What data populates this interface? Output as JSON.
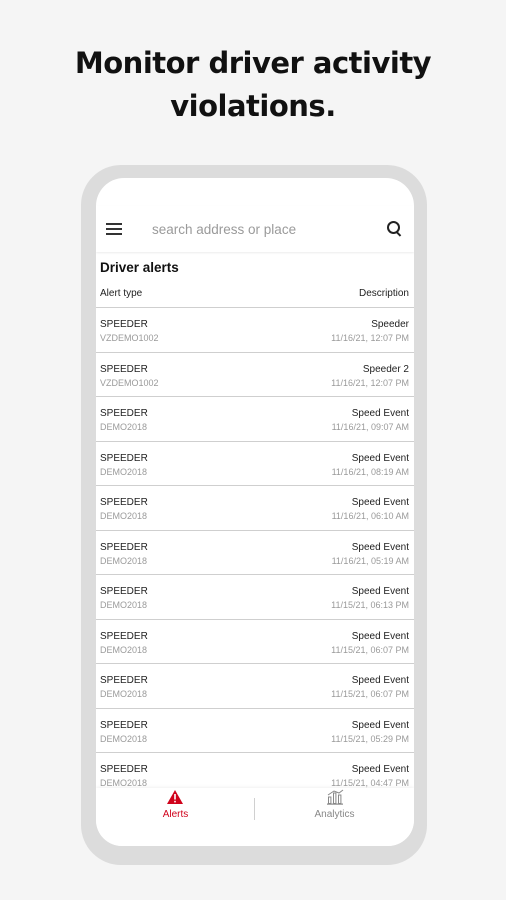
{
  "headline": {
    "line1": "Monitor driver activity",
    "line2": "violations."
  },
  "search": {
    "placeholder": "search address or place"
  },
  "section_title": "Driver alerts",
  "columns": {
    "left": "Alert type",
    "right": "Description"
  },
  "alerts": [
    {
      "type": "SPEEDER",
      "driver": "VZDEMO1002",
      "description": "Speeder",
      "time": "11/16/21, 12:07 PM"
    },
    {
      "type": "SPEEDER",
      "driver": "VZDEMO1002",
      "description": "Speeder 2",
      "time": "11/16/21, 12:07 PM"
    },
    {
      "type": "SPEEDER",
      "driver": "DEMO2018",
      "description": "Speed Event",
      "time": "11/16/21, 09:07 AM"
    },
    {
      "type": "SPEEDER",
      "driver": "DEMO2018",
      "description": "Speed Event",
      "time": "11/16/21, 08:19 AM"
    },
    {
      "type": "SPEEDER",
      "driver": "DEMO2018",
      "description": "Speed Event",
      "time": "11/16/21, 06:10 AM"
    },
    {
      "type": "SPEEDER",
      "driver": "DEMO2018",
      "description": "Speed Event",
      "time": "11/16/21, 05:19 AM"
    },
    {
      "type": "SPEEDER",
      "driver": "DEMO2018",
      "description": "Speed Event",
      "time": "11/15/21, 06:13 PM"
    },
    {
      "type": "SPEEDER",
      "driver": "DEMO2018",
      "description": "Speed Event",
      "time": "11/15/21, 06:07 PM"
    },
    {
      "type": "SPEEDER",
      "driver": "DEMO2018",
      "description": "Speed Event",
      "time": "11/15/21, 06:07 PM"
    },
    {
      "type": "SPEEDER",
      "driver": "DEMO2018",
      "description": "Speed Event",
      "time": "11/15/21, 05:29 PM"
    },
    {
      "type": "SPEEDER",
      "driver": "DEMO2018",
      "description": "Speed Event",
      "time": "11/15/21, 04:47 PM"
    }
  ],
  "nav": {
    "alerts": "Alerts",
    "analytics": "Analytics"
  },
  "colors": {
    "accent": "#d0021b",
    "background": "#f5f5f5",
    "phone_frame": "#dcdcdc"
  },
  "icons": {
    "menu": "hamburger-menu-icon",
    "search": "search-icon",
    "alerts": "warning-triangle-icon",
    "analytics": "bar-chart-icon"
  }
}
